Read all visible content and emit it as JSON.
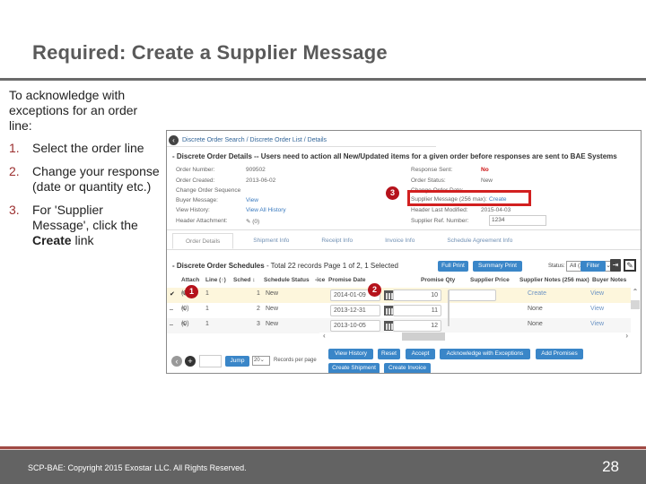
{
  "slide": {
    "title": "Required:  Create a Supplier Message",
    "intro": "To acknowledge with exceptions for an order line:",
    "steps": [
      {
        "num": "1.",
        "text": "Select the order line"
      },
      {
        "num": "2.",
        "text": "Change your response (date or quantity etc.)"
      },
      {
        "num": "3.",
        "text_before": "For 'Supplier Message', click the ",
        "bold": "Create",
        "text_after": " link"
      }
    ],
    "footer": {
      "copyright": "SCP-BAE:  Copyright 2015 Exostar LLC. All Rights Reserved.",
      "page_number": "28"
    }
  },
  "app": {
    "breadcrumb": "Discrete Order Search / Discrete Order List / Details",
    "details_title": "- Discrete Order Details -- Users need to action all New/Updated items for a given order before responses are sent to BAE Systems",
    "left_fields": [
      {
        "label": "Order Number:",
        "value": "909502",
        "type": "text"
      },
      {
        "label": "Order Created:",
        "value": "2013-06-02",
        "type": "text"
      },
      {
        "label": "Change Order Sequence",
        "value": "",
        "type": "text"
      },
      {
        "label": "Buyer Message:",
        "value": "View",
        "type": "link"
      },
      {
        "label": "View History:",
        "value": "View All History",
        "type": "link"
      },
      {
        "label": "Header Attachment:",
        "value": "(0)",
        "type": "attach"
      }
    ],
    "right_fields": [
      {
        "label": "Response Sent:",
        "value": "No",
        "type": "red"
      },
      {
        "label": "Order Status:",
        "value": "New",
        "type": "text"
      },
      {
        "label": "Change Order Date:",
        "value": "",
        "type": "text"
      },
      {
        "label": "Supplier Message (256 max):",
        "value": "Create",
        "type": "link"
      },
      {
        "label": "Header Last Modified:",
        "value": "2015-04-03",
        "type": "text"
      },
      {
        "label": "Supplier Ref. Number:",
        "value": "",
        "type": "input"
      }
    ],
    "supplier_ref_value": "1234",
    "tabs": [
      "Order Details",
      "Shipment Info",
      "Receipt Info",
      "Invoice Info",
      "Schedule Agreement Info"
    ],
    "schedules_title_bold": "- Discrete Order Schedules",
    "schedules_title_rest": " - Total 22 records Page 1 of 2, 1 Selected",
    "buttons_top": {
      "full_print": "Full Print",
      "summary_print": "Summary Print",
      "filter": "Filter"
    },
    "status_label": "Status:",
    "status_value": "All (22)",
    "columns": [
      "Attach",
      "Line (↑)",
      "Sched ↕",
      "Schedule Status",
      "-ice",
      "Promise Date",
      "Promise Qty",
      "Supplier Price",
      "Supplier Notes (256 max)",
      "Buyer Notes"
    ],
    "rows": [
      {
        "selected": true,
        "check": "✔",
        "attach": "(0)",
        "line": "1",
        "sched": "1",
        "status": "New",
        "promise_date": "2014-01-09",
        "promise_qty": "10",
        "supplier_price": "",
        "supplier_notes": "Create",
        "buyer_notes": "View"
      },
      {
        "selected": false,
        "check": "",
        "attach": "(0)",
        "line": "1",
        "sched": "2",
        "status": "New",
        "promise_date": "2013-12-31",
        "promise_qty": "11",
        "supplier_price": "",
        "supplier_notes": "None",
        "buyer_notes": "View"
      },
      {
        "selected": false,
        "check": "",
        "attach": "(0)",
        "line": "1",
        "sched": "3",
        "status": "New",
        "promise_date": "2013-10-05",
        "promise_qty": "12",
        "supplier_price": "",
        "supplier_notes": "None",
        "buyer_notes": "View"
      }
    ],
    "pager": {
      "jump": "Jump",
      "rpp_value": "20",
      "rpp_label": "Records per page"
    },
    "action_buttons": {
      "view_history": "View History",
      "reset": "Reset",
      "accept": "Accept",
      "ack_exceptions": "Acknowledge with Exceptions",
      "add_promises": "Add Promises",
      "create_shipment": "Create Shipment",
      "create_invoice": "Create Invoice"
    },
    "callouts": [
      "1",
      "2",
      "3"
    ],
    "colors": {
      "accent_button": "#3a86c8",
      "callout": "#b5121b",
      "highlight": "#d22020",
      "link": "#3a7abf"
    }
  }
}
